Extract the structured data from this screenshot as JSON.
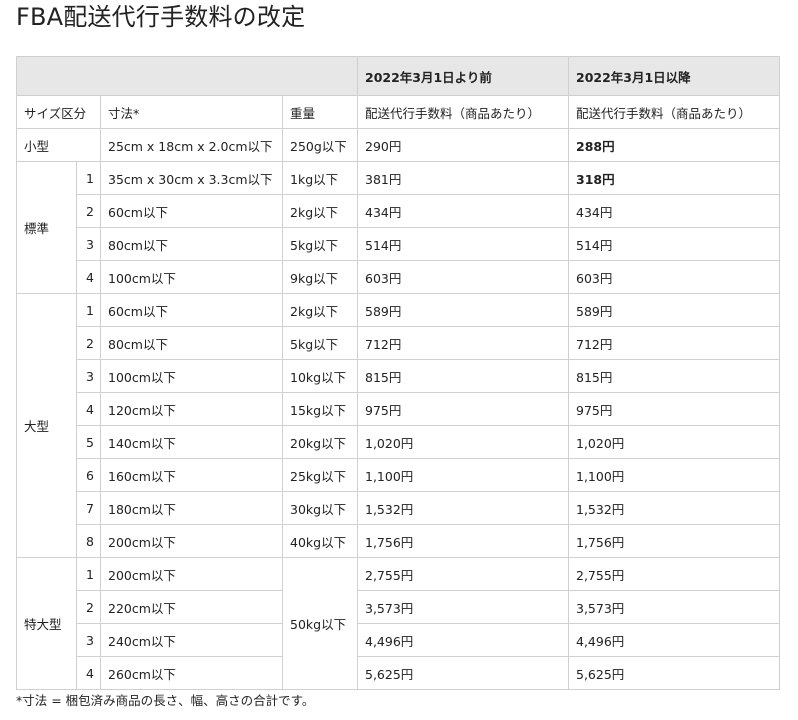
{
  "title": "FBA配送代行手数料の改定",
  "header": {
    "period_before": "2022年3月1日より前",
    "period_after": "2022年3月1日以降"
  },
  "columns": {
    "size_class": "サイズ区分",
    "dimensions": "寸法*",
    "weight": "重量",
    "fee_before": "配送代行手数料（商品あたり）",
    "fee_after": "配送代行手数料（商品あたり）"
  },
  "groups": {
    "small": "小型",
    "standard": "標準",
    "large": "大型",
    "extra_large": "特大型"
  },
  "rows": [
    {
      "num": "",
      "dim": "25cm x 18cm x 2.0cm以下",
      "weight": "250g以下",
      "before": "290円",
      "after": "288円"
    },
    {
      "num": "1",
      "dim": "35cm x 30cm x 3.3cm以下",
      "weight": "1kg以下",
      "before": "381円",
      "after": "318円"
    },
    {
      "num": "2",
      "dim": "60cm以下",
      "weight": "2kg以下",
      "before": "434円",
      "after": "434円"
    },
    {
      "num": "3",
      "dim": "80cm以下",
      "weight": "5kg以下",
      "before": "514円",
      "after": "514円"
    },
    {
      "num": "4",
      "dim": "100cm以下",
      "weight": "9kg以下",
      "before": "603円",
      "after": "603円"
    },
    {
      "num": "1",
      "dim": "60cm以下",
      "weight": "2kg以下",
      "before": "589円",
      "after": "589円"
    },
    {
      "num": "2",
      "dim": "80cm以下",
      "weight": "5kg以下",
      "before": "712円",
      "after": "712円"
    },
    {
      "num": "3",
      "dim": "100cm以下",
      "weight": "10kg以下",
      "before": "815円",
      "after": "815円"
    },
    {
      "num": "4",
      "dim": "120cm以下",
      "weight": "15kg以下",
      "before": "975円",
      "after": "975円"
    },
    {
      "num": "5",
      "dim": "140cm以下",
      "weight": "20kg以下",
      "before": "1,020円",
      "after": "1,020円"
    },
    {
      "num": "6",
      "dim": "160cm以下",
      "weight": "25kg以下",
      "before": "1,100円",
      "after": "1,100円"
    },
    {
      "num": "7",
      "dim": "180cm以下",
      "weight": "30kg以下",
      "before": "1,532円",
      "after": "1,532円"
    },
    {
      "num": "8",
      "dim": "200cm以下",
      "weight": "40kg以下",
      "before": "1,756円",
      "after": "1,756円"
    },
    {
      "num": "1",
      "dim": "200cm以下",
      "weight": "50kg以下",
      "before": "2,755円",
      "after": "2,755円"
    },
    {
      "num": "2",
      "dim": "220cm以下",
      "weight": "",
      "before": "3,573円",
      "after": "3,573円"
    },
    {
      "num": "3",
      "dim": "240cm以下",
      "weight": "",
      "before": "4,496円",
      "after": "4,496円"
    },
    {
      "num": "4",
      "dim": "260cm以下",
      "weight": "",
      "before": "5,625円",
      "after": "5,625円"
    }
  ],
  "footnote": "*寸法 = 梱包済み商品の長さ、幅、高さの合計です。"
}
